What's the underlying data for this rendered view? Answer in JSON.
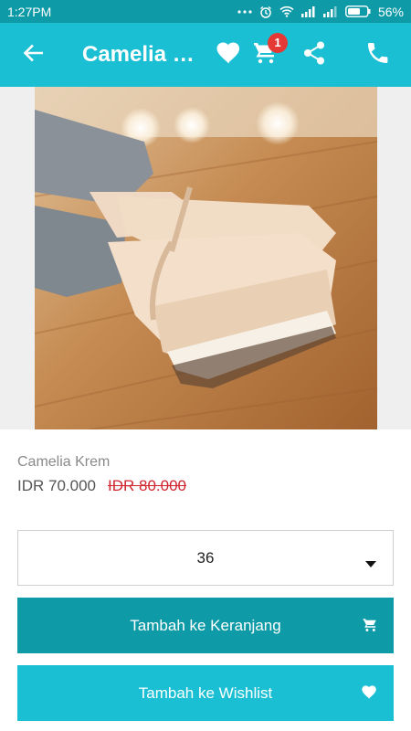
{
  "status_bar": {
    "time": "1:27PM",
    "battery": "56%",
    "icons": [
      "more-icon",
      "alarm-icon",
      "wifi-icon",
      "signal-icon",
      "signal-icon",
      "battery-icon"
    ]
  },
  "app_bar": {
    "title": "Camelia Krem",
    "cart_count": "1",
    "icons": [
      "back-arrow-icon",
      "heart-icon",
      "cart-icon",
      "share-icon",
      "phone-icon"
    ]
  },
  "product": {
    "name": "Camelia Krem",
    "price": "IDR 70.000",
    "old_price": "IDR 80.000"
  },
  "size_select": {
    "value": "36"
  },
  "buttons": {
    "add_to_cart": "Tambah ke Keranjang",
    "add_to_wishlist": "Tambah ke Wishlist"
  },
  "colors": {
    "primary": "#1bbfd3",
    "primary_dark": "#0e9aa7",
    "discount_red": "#d0252f",
    "badge_red": "#e53935"
  }
}
